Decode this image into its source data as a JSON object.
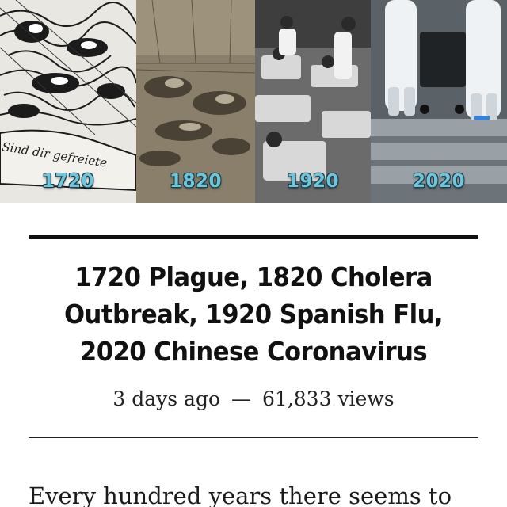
{
  "hero": {
    "panels": [
      {
        "year": "1720",
        "caption": "Sind dir gefreiete",
        "icon": "woodcut-engraving-image"
      },
      {
        "year": "1820",
        "icon": "sepia-engraving-image"
      },
      {
        "year": "1920",
        "icon": "hospital-ward-photo"
      },
      {
        "year": "2020",
        "icon": "hazmat-workers-photo"
      }
    ]
  },
  "article": {
    "title": "1720 Plague, 1820 Cholera Outbreak, 1920 Spanish Flu, 2020 Chinese Coronavirus",
    "posted": "3 days ago",
    "separator": "—",
    "views": "61,833 views",
    "body_start": "Every hundred years there seems to"
  },
  "colors": {
    "year_label": "#6fc6da",
    "rule": "#111111",
    "text": "#111111"
  }
}
